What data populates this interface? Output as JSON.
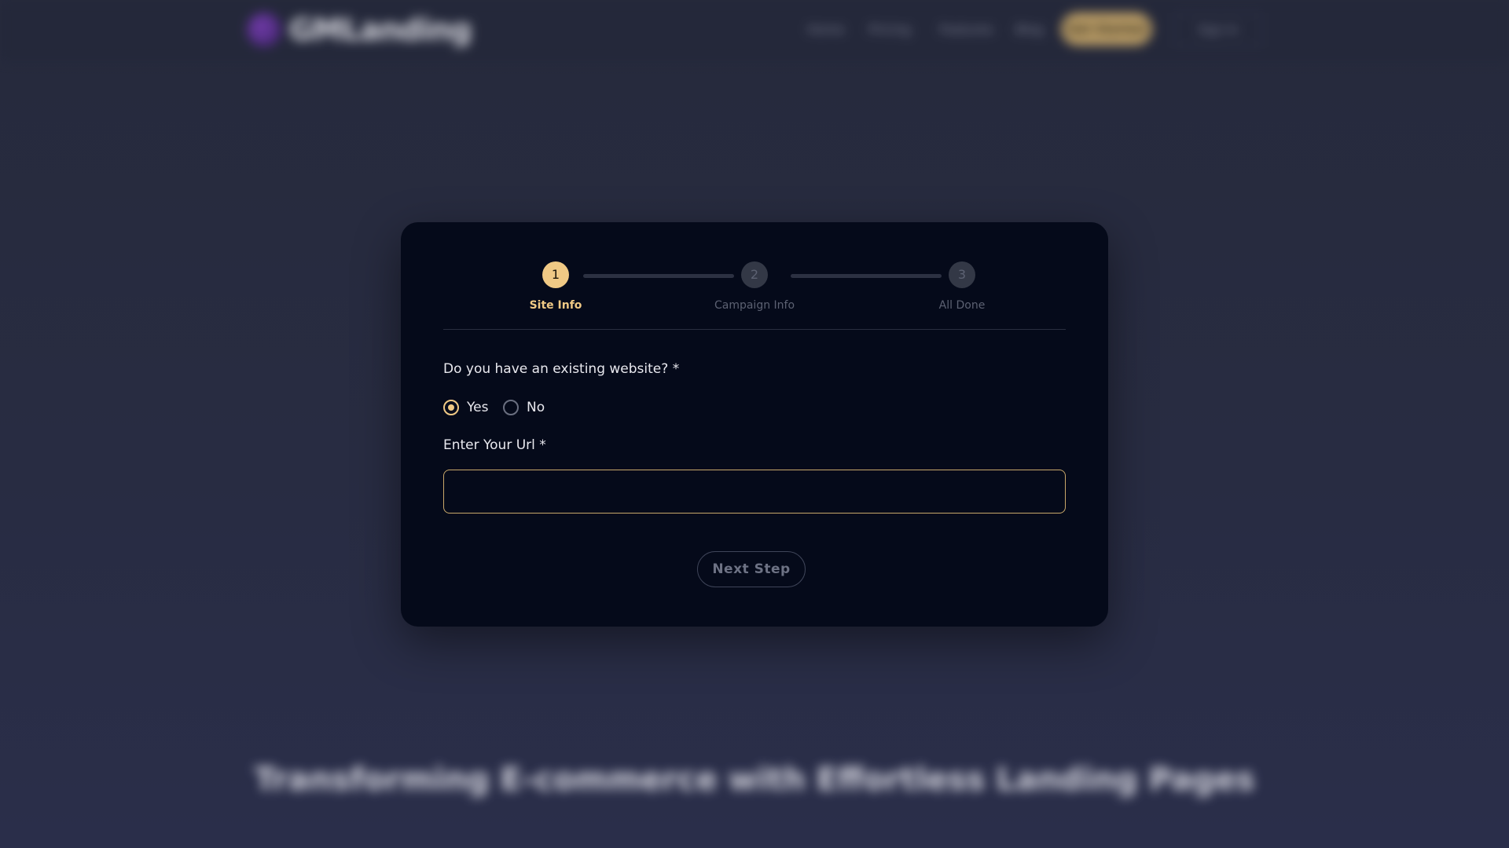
{
  "background": {
    "logo_text": "GMLanding",
    "nav_links": [
      "Home",
      "Pricing",
      "Features",
      "Blog"
    ],
    "cta_label": "Get Started",
    "login_label": "Sign In",
    "hero_title": "Transforming E-commerce with Effortless Landing Pages"
  },
  "stepper": {
    "steps": [
      {
        "number": "1",
        "label": "Site Info",
        "state": "active"
      },
      {
        "number": "2",
        "label": "Campaign Info",
        "state": "inactive"
      },
      {
        "number": "3",
        "label": "All Done",
        "state": "inactive"
      }
    ]
  },
  "form": {
    "question": "Do you have an existing website? *",
    "options": [
      {
        "label": "Yes",
        "checked": true
      },
      {
        "label": "No",
        "checked": false
      }
    ],
    "url_label": "Enter Your Url *",
    "url_value": "",
    "url_placeholder": "",
    "next_label": "Next Step"
  },
  "colors": {
    "accent": "#f0c985",
    "card_bg": "#050a1a",
    "page_bg": "#272b3f"
  }
}
